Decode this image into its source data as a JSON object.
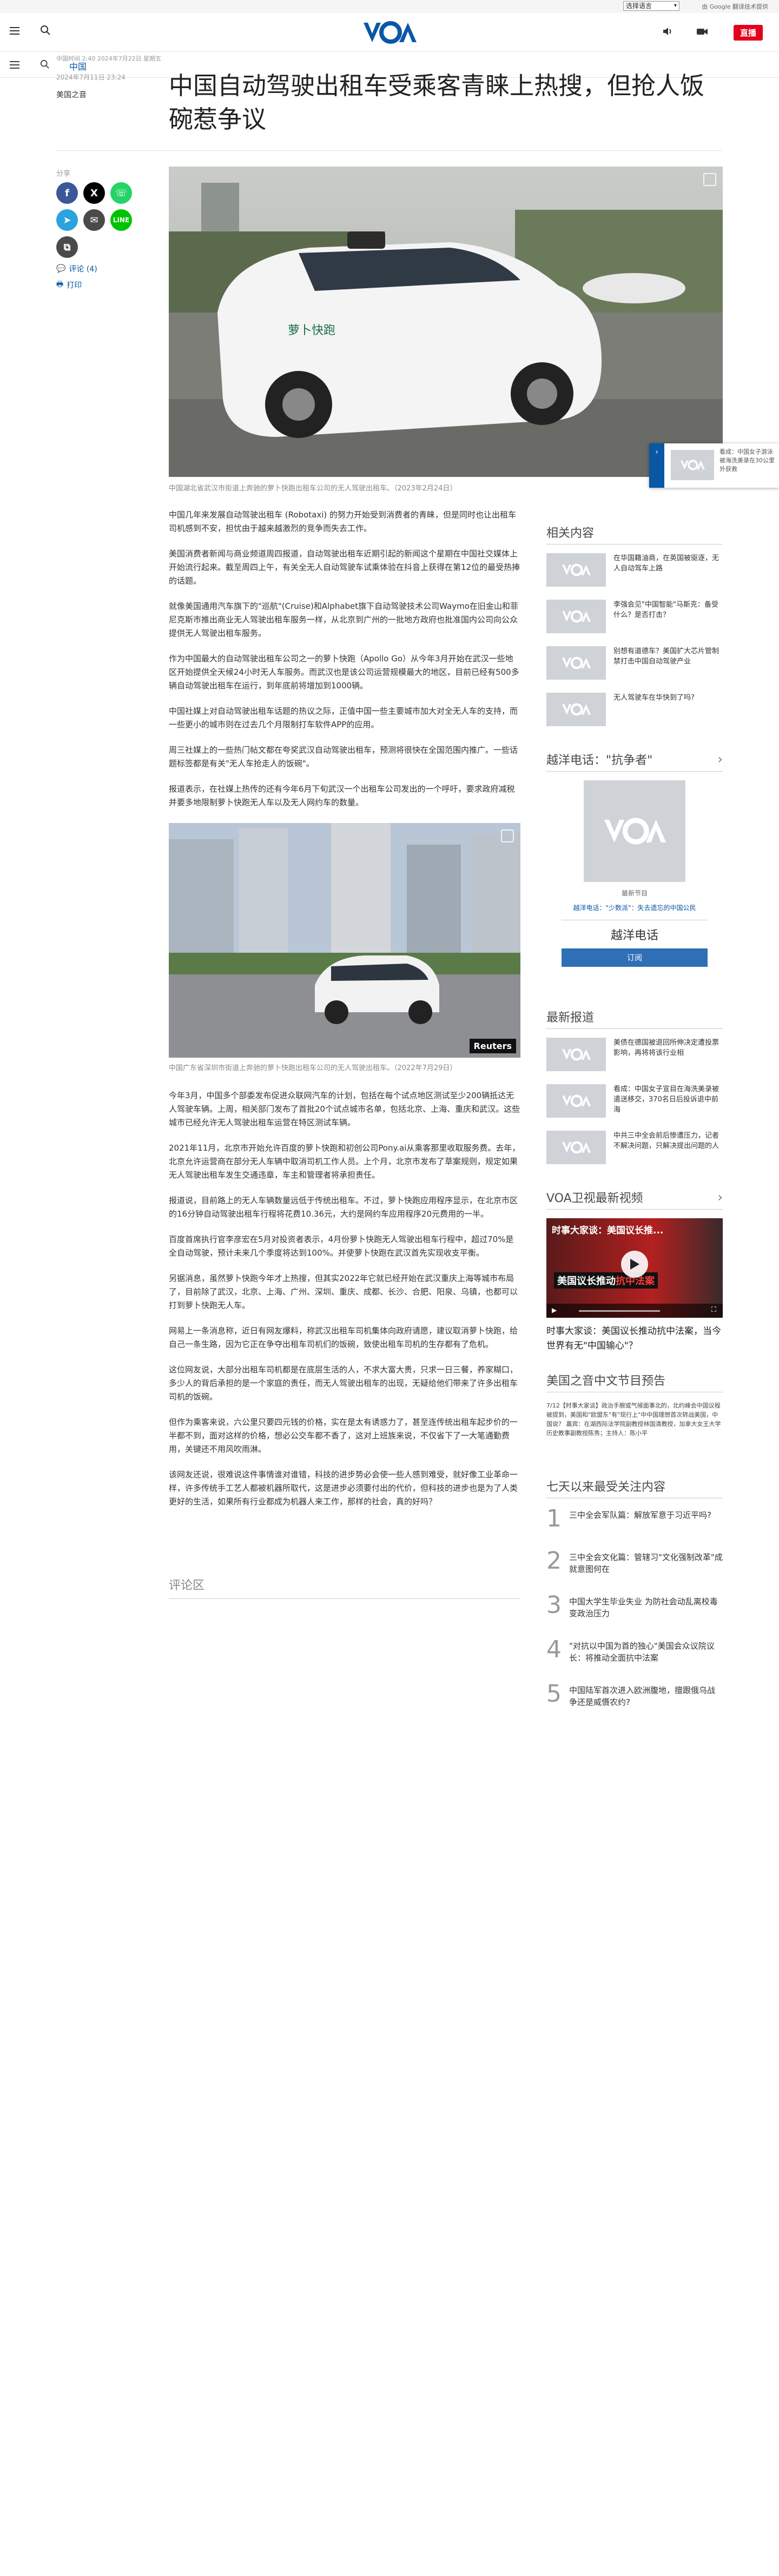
{
  "topbar": {
    "language_select": "选择语言",
    "google_translate": "由 Google 翻译技术提供"
  },
  "header": {
    "logo_text": "VOA",
    "live_label": "直播"
  },
  "subnav": {
    "category": "中国"
  },
  "article": {
    "updated": "中国时间 2:40 2024年7月22日 星期五",
    "date": "2024年7月11日 23:24",
    "author": "美国之音",
    "title": "中国自动驾驶出租车受乘客青睐上热搜，但抢人饭碗惹争议",
    "share_label": "分享",
    "comments_link": "评论 (4)",
    "print_link": "打印",
    "image1_caption": "中国湖北省武汉市街道上奔驰的萝卜快跑出租车公司的无人驾驶出租车。（2023年2月24日）",
    "image2_caption": "中国广东省深圳市街道上奔驰的萝卜快跑出租车公司的无人驾驶出租车。（2022年7月29日）",
    "image2_credit": "Reuters",
    "image1_car_text": "萝卜快跑",
    "paragraphs1": [
      "中国几年来发展自动驾驶出租车 (Robotaxi) 的努力开始受到消费者的青睐，但是同时也让出租车司机感到不安，担忧由于越来越激烈的竞争而失去工作。",
      "美国消费者新闻与商业频道周四报道，自动驾驶出租车近期引起的新闻这个星期在中国社交媒体上开始流行起来。截至周四上午，有关全无人自动驾驶车试乘体验在抖音上获得在第12位的最受热捧的话题。",
      "就像美国通用汽车旗下的\"巡航\"(Cruise)和Alphabet旗下自动驾驶技术公司Waymo在旧金山和菲尼克斯市推出商业无人驾驶出租车服务一样，从北京到广州的一批地方政府也批准国内公司向公众提供无人驾驶出租车服务。",
      "作为中国最大的自动驾驶出租车公司之一的萝卜快跑（Apollo Go）从今年3月开始在武汉一些地区开始提供全天候24小时无人车服务。而武汉也是该公司运营规模最大的地区，目前已经有500多辆自动驾驶出租车在运行，到年底前将增加到1000辆。",
      "中国社媒上对自动驾驶出租车话题的热议之际，正值中国一些主要城市加大对全无人车的支持，而一些更小的城市则在过去几个月限制打车软件APP的应用。",
      "周三社媒上的一些热门帖文都在夸奖武汉自动驾驶出租车，预测将很快在全国范围内推广。一些话题标签都是有关\"无人车抢走人的饭碗\"。",
      "报道表示，在社媒上热传的还有今年6月下旬武汉一个出租车公司发出的一个呼吁，要求政府减税并要多地限制萝卜快跑无人车以及无人网约车的数量。"
    ],
    "paragraphs2": [
      "今年3月，中国多个部委发布促进众联网汽车的计划，包括在每个试点地区测试至少200辆抵达无人驾驶车辆。上周，相关部门发布了首批20个试点城市名单，包括北京、上海、重庆和武汉。这些城市已经允许无人驾驶出租车运营在特区测试车辆。",
      "2021年11月，北京市开始允许百度的萝卜快跑和初创公司Pony.ai从乘客那里收取服务费。去年，北京允许运营商在部分无人车辆中取消司机工作人员。上个月，北京市发布了草案规则，规定如果无人驾驶出租车发生交通违章，车主和管理者将承担责任。",
      "报道说，目前路上的无人车辆数量远低于传统出租车。不过，萝卜快跑应用程序显示，在北京市区的16分钟自动驾驶出租车行程将花费10.36元，大约是网约车应用程序20元费用的一半。",
      "百度首席执行官李彦宏在5月对投资者表示，4月份萝卜快跑无人驾驶出租车行程中，超过70%是全自动驾驶，预计未来几个季度将达到100%。并使萝卜快跑在武汉首先实现收支平衡。",
      "另据消息，虽然萝卜快跑今年才上热搜，但其实2022年它就已经开始在武汉重庆上海等城市布局了，目前除了武汉，北京、上海、广州、深圳、重庆、成都、长沙、合肥、阳泉、乌镇，也都可以打到萝卜快跑无人车。",
      "网易上一条消息称，近日有网友爆料，称武汉出租车司机集体向政府请愿，建议取消萝卜快跑，给自己一条生路，因为它正在争夺出租车司机们的饭碗，致使出租车司机的生存都有了危机。",
      "这位网友说，大部分出租车司机都是在底层生活的人，不求大富大贵，只求一日三餐，养家糊口，多少人的背后承担的是一个家庭的责任，而无人驾驶出租车的出现，无疑给他们带来了许多出租车司机的饭碗。",
      "但作为乘客来说，六公里只要四元钱的价格，实在是太有诱惑力了，甚至连传统出租车起步价的一半都不到，面对这样的价格，想必公交车都不香了，这对上班族来说，不仅省下了一大笔通勤费用，关键还不用风吹雨淋。",
      "该网友还说，很难说这件事情谁对谁错，科技的进步势必会使一些人感到难受，就好像工业革命一样，许多传统手工艺人都被机器所取代，这是进步必须要付出的代价，但科技的进步也是为了人类更好的生活，如果所有行业都成为机器人来工作，那样的社会，真的好吗？"
    ],
    "comments_heading": "评论区"
  },
  "sidebar": {
    "related_heading": "相关内容",
    "related": [
      "在华国籍油商，在英国被驱逐，无人自动驾车上路",
      "李强会见\"中国智能\"马斯克：备受什么？是否打击？",
      "别想有道德车？美国扩大芯片管制禁打击中国自动驾驶产业",
      "无人驾驶车在华快到了吗?"
    ],
    "hotline_heading": "越洋电话：\"抗争者\"",
    "hotline_latest": "最新节目",
    "hotline_episode": "越洋电话：\"少数派\"：失去遗忘的中国公民",
    "hotline_title": "越洋电话",
    "subscribe_label": "订阅",
    "latest_heading": "最新报道",
    "latest": [
      "美债在德国被退回所伸决定遭投票影响，再将将该行业相",
      "看成：中国女子宣目在海洗美录被遣送移交，370名日后投诉退中前海",
      "中共三中全会前后惨遭压力，记者 不解决问题，只解决提出问题的人"
    ],
    "video_heading": "VOA卫视最新视频",
    "video_overlay_title": "时事大家谈：美国议长推...",
    "video_banner_red": "抗中法案",
    "video_banner_white": "美国议长推动",
    "video_caption": "时事大家谈：美国议长推动抗中法案，当今世界有无\"中国输心\"？",
    "schedule_heading": "美国之音中文节目预告",
    "schedule_text": "7/12【时事大家谈】政治手腕或气候面事北的，北约峰会中国议程被提到，美国和\"欧盟东\"有\"现行上\"中中国理想首次转战美国，中国说？ 嘉宾：在湖西际法学院副教授林国清教授，加拿大女王大学历史教事副教授陈秀；主持人：陈小平",
    "popular_heading": "七天以来最受关注内容",
    "popular": [
      "三中全会军队篇：解放军意于习近平吗?",
      "三中全会文化篇：管辖习\"文化强制改革\"成就意图何在",
      "中国大学生毕业失业 为防社会动乱离校毒变政治压力",
      "\"对抗以中国为首的独心\"美国会众议院议长：将推动全面抗中法案",
      "中国陆军首次进入欧洲腹地，擅跟俄乌战争还是威慑农约?"
    ],
    "popular_numbers": [
      "1",
      "2",
      "3",
      "4",
      "5"
    ]
  },
  "popup": {
    "text": "看成：中国女子游泳被海洗美录在30公里外获救"
  },
  "icons": {
    "hamburger": "menu-icon",
    "search": "search-icon",
    "audio": "audio-icon",
    "video": "video-camera-icon",
    "expand": "expand-icon",
    "play": "play-icon",
    "chevron": "chevron-right-icon"
  },
  "colors": {
    "brand": "#0a57a5",
    "live": "#e3001b",
    "facebook": "#3b5998",
    "twitter": "#000000",
    "whatsapp": "#25d366",
    "telegram": "#2aa3de",
    "email": "#4a4a4a",
    "line": "#00c300",
    "link": "#0a57a5"
  }
}
